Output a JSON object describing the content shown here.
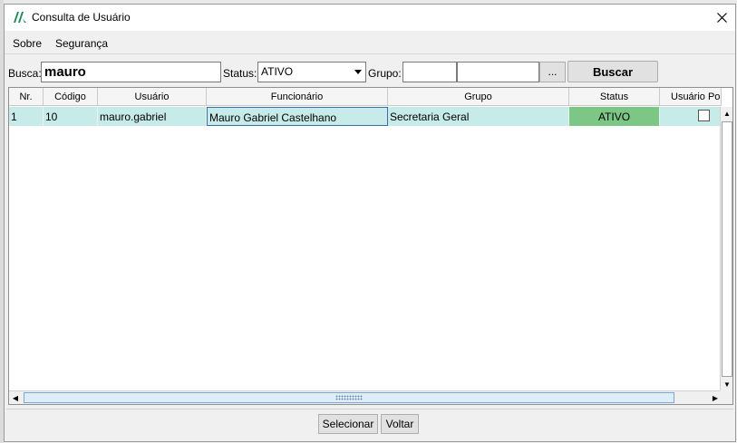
{
  "window": {
    "title": "Consulta de Usuário"
  },
  "menu": {
    "items": [
      "Sobre",
      "Segurança"
    ]
  },
  "filters": {
    "busca_label": "Busca:",
    "busca_value": "mauro",
    "status_label": "Status:",
    "status_value": "ATIVO",
    "grupo_label": "Grupo:",
    "grupo_code": "",
    "grupo_name": "",
    "ellipsis_label": "...",
    "buscar_label": "Buscar"
  },
  "grid": {
    "columns": [
      "Nr.",
      "Código",
      "Usuário",
      "Funcionário",
      "Grupo",
      "Status",
      "Usuário Po"
    ],
    "rows": [
      {
        "nr": "1",
        "codigo": "10",
        "usuario": "mauro.gabriel",
        "funcionario": "Mauro Gabriel Castelhano",
        "grupo": "Secretaria Geral",
        "status": "ATIVO",
        "usuario_po": false
      }
    ]
  },
  "footer": {
    "selecionar_label": "Selecionar",
    "voltar_label": "Voltar"
  },
  "colors": {
    "row_bg": "#c6ebe8",
    "status_bg": "#7dc786",
    "accent": "#3d6ea9"
  },
  "icons": {
    "app": "app-logo-icon",
    "close": "close-icon"
  }
}
